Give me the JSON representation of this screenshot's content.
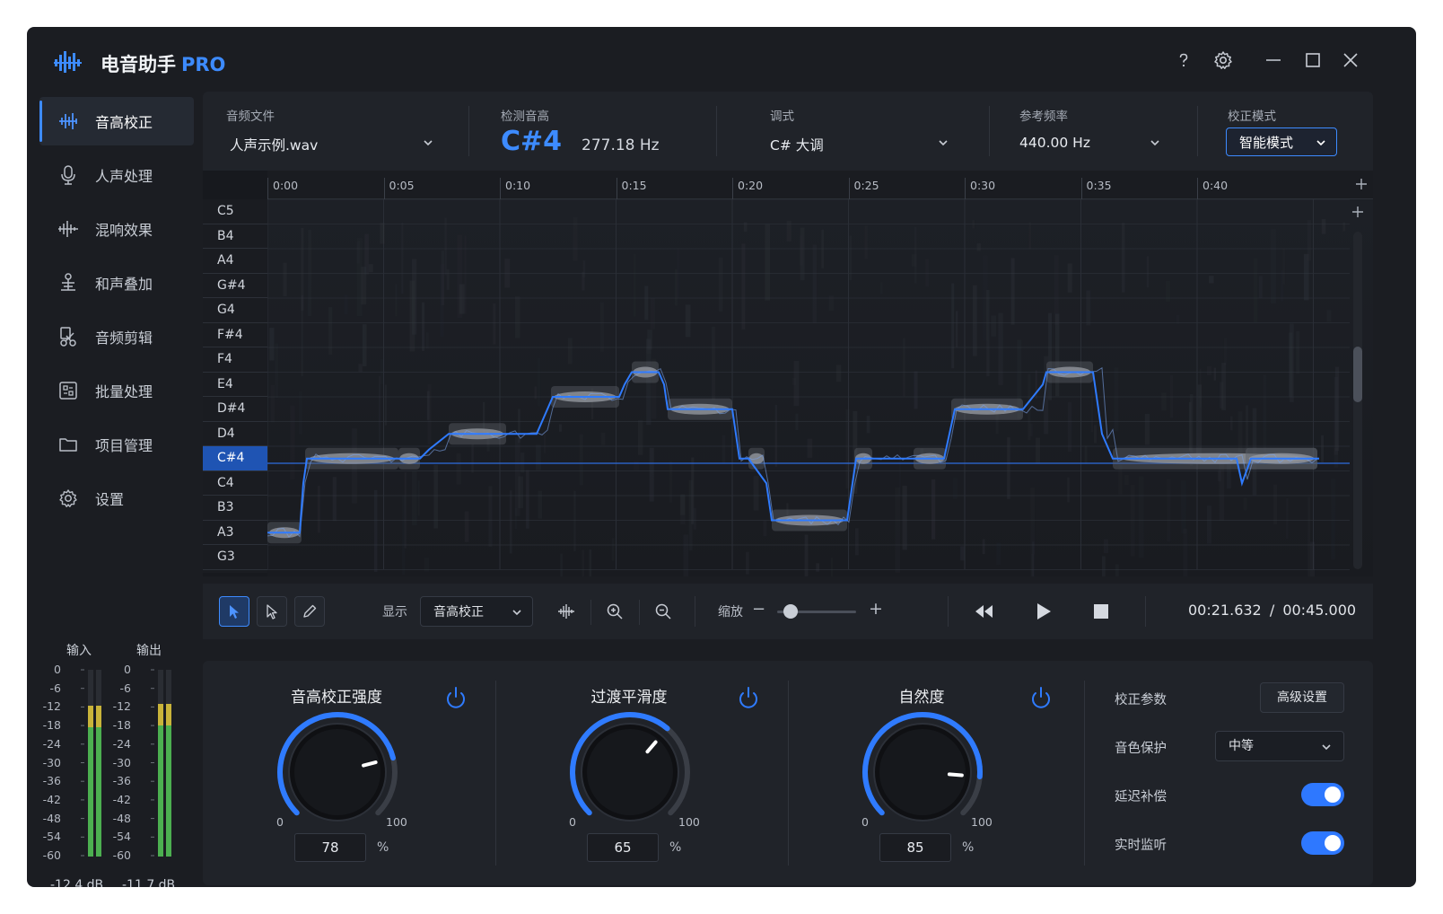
{
  "app": {
    "title": "电音助手",
    "badge": "PRO"
  },
  "window": {
    "help_icon": "question-icon",
    "settings_icon": "gear-icon"
  },
  "sidebar": {
    "items": [
      {
        "label": "音高校正",
        "icon": "waveform-icon",
        "active": true
      },
      {
        "label": "人声处理",
        "icon": "microphone-icon"
      },
      {
        "label": "混响效果",
        "icon": "reverb-icon"
      },
      {
        "label": "和声叠加",
        "icon": "harmony-icon"
      },
      {
        "label": "音频剪辑",
        "icon": "audio-edit-icon"
      },
      {
        "label": "批量处理",
        "icon": "batch-icon"
      },
      {
        "label": "项目管理",
        "icon": "folder-icon"
      },
      {
        "label": "设置",
        "icon": "gear-icon"
      }
    ],
    "meters": {
      "input_label": "输入",
      "output_label": "输出",
      "scale": [
        "0",
        "-6",
        "-12",
        "-18",
        "-24",
        "-30",
        "-36",
        "-42",
        "-48",
        "-54",
        "-60"
      ],
      "input_db": "-12.4 dB",
      "output_db": "-11.7 dB"
    }
  },
  "params": {
    "file": {
      "label": "音频文件",
      "value": "人声示例.wav"
    },
    "detected": {
      "label": "检测音高",
      "note": "C#4",
      "hz": "277.18 Hz"
    },
    "key": {
      "label": "调式",
      "value": "C# 大调"
    },
    "ref_freq": {
      "label": "参考频率",
      "value": "440.00 Hz"
    },
    "mode": {
      "label": "校正模式",
      "value": "智能模式"
    }
  },
  "editor": {
    "time_ticks": [
      "0:00",
      "0:05",
      "0:10",
      "0:15",
      "0:20",
      "0:25",
      "0:30",
      "0:35",
      "0:40"
    ],
    "notes": [
      "C5",
      "B4",
      "A4",
      "G#4",
      "G4",
      "F#4",
      "F4",
      "E4",
      "D#4",
      "D4",
      "C#4",
      "C4",
      "B3",
      "A3",
      "G3"
    ],
    "active_note": "C#4"
  },
  "toolbar": {
    "display_label": "显示",
    "display_value": "音高校正",
    "zoom_label": "缩放",
    "zoom_minus": "−",
    "zoom_plus": "+",
    "time_current": "00:21.632",
    "time_sep": "/",
    "time_total": "00:45.000"
  },
  "controls": {
    "knobs": [
      {
        "title": "音高校正强度",
        "value": "78",
        "min": "0",
        "max": "100",
        "unit": "%"
      },
      {
        "title": "过渡平滑度",
        "value": "65",
        "min": "0",
        "max": "100",
        "unit": "%"
      },
      {
        "title": "自然度",
        "value": "85",
        "min": "0",
        "max": "100",
        "unit": "%"
      }
    ],
    "side": {
      "correction_params_label": "校正参数",
      "advanced_button": "高级设置",
      "timbre_label": "音色保护",
      "timbre_value": "中等",
      "latency_label": "延迟补偿",
      "latency_on": true,
      "monitor_label": "实时监听",
      "monitor_on": true
    }
  },
  "colors": {
    "accent": "#3d8bff",
    "bg": "#1b1d22",
    "panel": "#202329"
  }
}
